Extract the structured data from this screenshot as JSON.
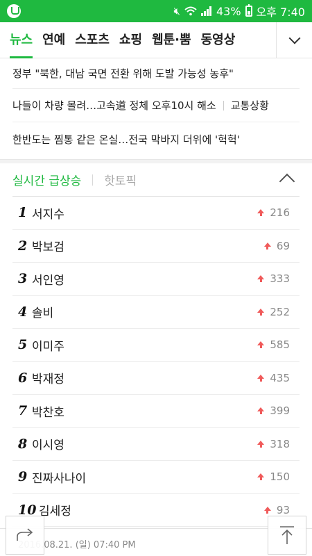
{
  "status_bar": {
    "battery": "43%",
    "time": "오후 7:40"
  },
  "tabs": [
    {
      "label": "뉴스",
      "active": true
    },
    {
      "label": "연예",
      "active": false
    },
    {
      "label": "스포츠",
      "active": false
    },
    {
      "label": "쇼핑",
      "active": false
    },
    {
      "label": "웹툰·뿜",
      "active": false
    },
    {
      "label": "동영상",
      "active": false
    }
  ],
  "headlines": [
    {
      "text": "정부 \"북한, 대남 국면 전환 위해 도발 가능성 농후\""
    },
    {
      "text": "나들이 차량 몰려…고속道 정체 오후10시 해소",
      "tag": "교통상황"
    },
    {
      "text": "한반도는 찜통 같은 온실…전국 막바지 더위에 '헉헉'"
    }
  ],
  "ranking": {
    "tab_realtime": "실시간 급상승",
    "tab_hot": "핫토픽",
    "items": [
      {
        "rank": "1",
        "name": "서지수",
        "change": "216"
      },
      {
        "rank": "2",
        "name": "박보검",
        "change": "69"
      },
      {
        "rank": "3",
        "name": "서인영",
        "change": "333"
      },
      {
        "rank": "4",
        "name": "솔비",
        "change": "252"
      },
      {
        "rank": "5",
        "name": "이미주",
        "change": "585"
      },
      {
        "rank": "6",
        "name": "박재정",
        "change": "435"
      },
      {
        "rank": "7",
        "name": "박찬호",
        "change": "399"
      },
      {
        "rank": "8",
        "name": "이시영",
        "change": "318"
      },
      {
        "rank": "9",
        "name": "진짜사나이",
        "change": "150"
      },
      {
        "rank": "10",
        "name": "김세정",
        "change": "93"
      }
    ]
  },
  "footer": {
    "timestamp": "2016.08.21. (일) 07:40 PM"
  },
  "colors": {
    "brand": "#1fb940",
    "trend_up": "#f05a5a"
  },
  "icons": [
    "app-icon",
    "mute-icon",
    "wifi-icon",
    "signal-icon",
    "battery-icon",
    "chevron-down-icon",
    "chevron-up-icon",
    "share-icon",
    "scroll-top-icon",
    "up-arrow-icon"
  ]
}
